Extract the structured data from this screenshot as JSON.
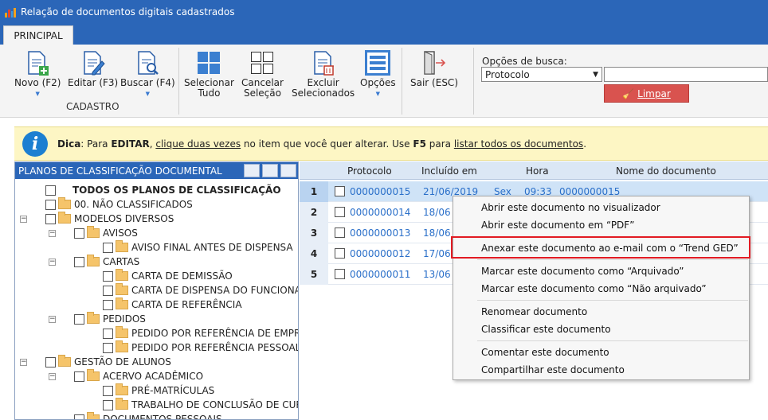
{
  "window": {
    "title": "Relação de documentos digitais cadastrados"
  },
  "tabs": [
    {
      "label": "PRINCIPAL"
    }
  ],
  "ribbon": {
    "new_label": "Novo (F2)",
    "edit_label": "Editar (F3)",
    "search_label": "Buscar (F4)",
    "group_cadastro": "CADASTRO",
    "select_all_1": "Selecionar",
    "select_all_2": "Tudo",
    "cancel_sel_1": "Cancelar",
    "cancel_sel_2": "Seleção",
    "delete_sel_1": "Excluir",
    "delete_sel_2": "Selecionados",
    "options_label": "Opções",
    "exit_label": "Sair (ESC)",
    "search_options_label": "Opções de busca:",
    "search_select_value": "Protocolo",
    "clear_label": "Limpar"
  },
  "hint": {
    "prefix": "Dica",
    "t1": ": Para ",
    "edit": "EDITAR",
    "t2": ", ",
    "link1": "clique duas vezes",
    "t3": " no item que você quer alterar. Use ",
    "key": "F5",
    "t4": " para ",
    "link2": "listar todos os documentos",
    "t5": "."
  },
  "tree": {
    "header": "PLANOS DE CLASSIFICAÇÃO DOCUMENTAL",
    "nodes": [
      {
        "label": "TODOS OS PLANOS DE CLASSIFICAÇÃO"
      },
      {
        "label": "00. NÃO CLASSIFICADOS"
      },
      {
        "label": "MODELOS DIVERSOS"
      },
      {
        "label": "AVISOS"
      },
      {
        "label": "AVISO FINAL ANTES DE DISPENSA"
      },
      {
        "label": "CARTAS"
      },
      {
        "label": "CARTA DE DEMISSÃO"
      },
      {
        "label": "CARTA DE DISPENSA DO FUNCIONA"
      },
      {
        "label": "CARTA DE REFERÊNCIA"
      },
      {
        "label": "PEDIDOS"
      },
      {
        "label": "PEDIDO POR REFERÊNCIA DE EMPR"
      },
      {
        "label": "PEDIDO POR REFERÊNCIA PESSOAL"
      },
      {
        "label": "GESTÃO DE ALUNOS"
      },
      {
        "label": "ACERVO ACADÊMICO"
      },
      {
        "label": "PRÉ-MATRÍCULAS"
      },
      {
        "label": "TRABALHO DE CONCLUSÃO DE CUR"
      },
      {
        "label": "DOCUMENTOS PESSOAIS"
      }
    ]
  },
  "grid": {
    "columns": [
      "Protocolo",
      "Incluído em",
      "Hora",
      "Nome do documento"
    ],
    "rows": [
      {
        "n": "1",
        "protocolo": "0000000015",
        "data": "21/06/2019",
        "dia": "Sex",
        "hora": "09:33",
        "nome": "0000000015"
      },
      {
        "n": "2",
        "protocolo": "0000000014",
        "data": "18/06"
      },
      {
        "n": "3",
        "protocolo": "0000000013",
        "data": "18/06"
      },
      {
        "n": "4",
        "protocolo": "0000000012",
        "data": "17/06"
      },
      {
        "n": "5",
        "protocolo": "0000000011",
        "data": "13/06"
      }
    ]
  },
  "context_menu": [
    "Abrir este documento no visualizador",
    "Abrir este documento em “PDF”",
    "Anexar este documento ao e-mail com o “Trend GED”",
    "Marcar este documento como “Arquivado”",
    "Marcar este documento como “Não arquivado”",
    "Renomear documento",
    "Classificar este documento",
    "Comentar este documento",
    "Compartilhar este documento"
  ],
  "colors": {
    "titlebar": "#2b66b8",
    "accent": "#2a6fc9",
    "clear_button": "#d9534f",
    "highlight": "#e21b23"
  }
}
